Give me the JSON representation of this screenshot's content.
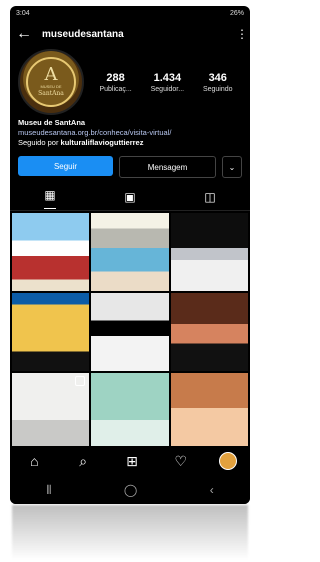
{
  "status": {
    "time": "3:04",
    "right_text": "26%"
  },
  "header": {
    "back_icon": "arrow-left-icon",
    "username": "museudesantana",
    "more_icon": "kebab-icon"
  },
  "profile": {
    "avatar": {
      "monogram": "A",
      "brand_line": "MUSEU DE",
      "name": "SantAna"
    },
    "stats": [
      {
        "value": "288",
        "label": "Publicaç..."
      },
      {
        "value": "1.434",
        "label": "Seguidor..."
      },
      {
        "value": "346",
        "label": "Seguindo"
      }
    ],
    "bio": {
      "name": "Museu de SantAna",
      "link": "museudesantana.org.br/conheca/visita-virtual/",
      "followed_by_prefix": "Seguido por ",
      "followed_by_user": "kulturaliflavioguttierrez"
    }
  },
  "actions": {
    "follow": "Seguir",
    "message": "Mensagem",
    "more_icon": "chevron-down-icon"
  },
  "tabs": [
    {
      "name": "posts-grid-tab",
      "icon": "▦"
    },
    {
      "name": "reels-tab",
      "icon": "▣"
    },
    {
      "name": "tagged-tab",
      "icon": "◫"
    }
  ],
  "grid": [
    {
      "name": "post-1"
    },
    {
      "name": "post-2"
    },
    {
      "name": "post-3"
    },
    {
      "name": "post-4"
    },
    {
      "name": "post-5"
    },
    {
      "name": "post-6"
    },
    {
      "name": "post-7",
      "reel": true
    },
    {
      "name": "post-8"
    },
    {
      "name": "post-9"
    }
  ],
  "bottom_nav": [
    {
      "name": "home-icon",
      "icon": "⌂"
    },
    {
      "name": "search-icon",
      "icon": "⌕"
    },
    {
      "name": "add-post-icon",
      "icon": "⊞"
    },
    {
      "name": "heart-icon",
      "icon": "♡"
    },
    {
      "name": "profile-avatar-icon",
      "icon": ""
    }
  ],
  "system_nav": [
    {
      "name": "recent-apps-icon",
      "icon": "⦀"
    },
    {
      "name": "home-circle-icon",
      "icon": "◯"
    },
    {
      "name": "back-chevron-icon",
      "icon": "‹"
    }
  ],
  "colors": {
    "accent": "#1a8ef3",
    "background": "#000000"
  }
}
